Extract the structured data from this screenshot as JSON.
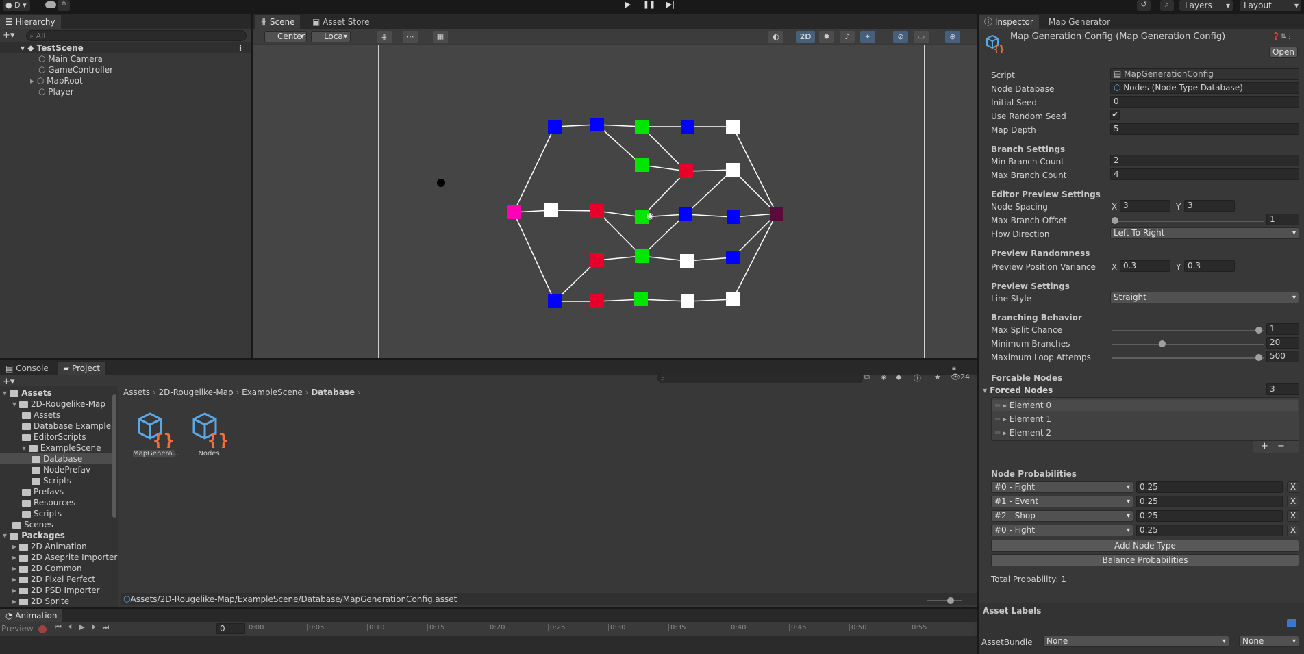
{
  "top": {
    "account": "D",
    "layers": "Layers",
    "layout": "Layout"
  },
  "hierarchy": {
    "tab": "Hierarchy",
    "search_placeholder": "All",
    "scene": "TestScene",
    "items": [
      "Main Camera",
      "GameController",
      "MapRoot",
      "Player"
    ]
  },
  "scene_view": {
    "tabs": [
      "Scene",
      "Asset Store"
    ],
    "pivot": "Center",
    "space": "Local",
    "mode_2d": "2D"
  },
  "project": {
    "tabs": [
      "Console",
      "Project"
    ],
    "count": "24",
    "tree": [
      {
        "label": "Assets",
        "level": 0,
        "bold": true
      },
      {
        "label": "2D-Rougelike-Map",
        "level": 1
      },
      {
        "label": "Assets",
        "level": 2
      },
      {
        "label": "Database Example",
        "level": 2
      },
      {
        "label": "EditorScripts",
        "level": 2
      },
      {
        "label": "ExampleScene",
        "level": 2
      },
      {
        "label": "Database",
        "level": 3
      },
      {
        "label": "NodePrefav",
        "level": 3
      },
      {
        "label": "Scripts",
        "level": 3
      },
      {
        "label": "Prefavs",
        "level": 2
      },
      {
        "label": "Resources",
        "level": 2
      },
      {
        "label": "Scripts",
        "level": 2
      },
      {
        "label": "Scenes",
        "level": 1
      },
      {
        "label": "Packages",
        "level": 0,
        "bold": true
      },
      {
        "label": "2D Animation",
        "level": 1
      },
      {
        "label": "2D Aseprite Importer",
        "level": 1
      },
      {
        "label": "2D Common",
        "level": 1
      },
      {
        "label": "2D Pixel Perfect",
        "level": 1
      },
      {
        "label": "2D PSD Importer",
        "level": 1
      },
      {
        "label": "2D Sprite",
        "level": 1
      }
    ],
    "breadcrumb": [
      "Assets",
      "2D-Rougelike-Map",
      "ExampleScene",
      "Database"
    ],
    "assets": [
      "MapGenera...",
      "Nodes"
    ],
    "path": "Assets/2D-Rougelike-Map/ExampleScene/Database/MapGenerationConfig.asset"
  },
  "animation": {
    "tab": "Animation",
    "preview": "Preview",
    "frame": "0",
    "ticks": [
      "0:00",
      "0:05",
      "0:10",
      "0:15",
      "0:20",
      "0:25",
      "0:30",
      "0:35",
      "0:40",
      "0:45",
      "0:50",
      "0:55"
    ]
  },
  "inspector": {
    "tabs": [
      "Inspector",
      "Map Generator"
    ],
    "title": "Map Generation Config (Map Generation Config)",
    "open": "Open",
    "script_label": "Script",
    "script_value": "MapGenerationConfig",
    "nodedb_label": "Node Database",
    "nodedb_value": "Nodes (Node Type Database)",
    "seed_label": "Initial Seed",
    "seed_value": "0",
    "random_label": "Use Random Seed",
    "depth_label": "Map Depth",
    "depth_value": "5",
    "branch_hdr": "Branch Settings",
    "minb_label": "Min Branch Count",
    "minb_value": "2",
    "maxb_label": "Max Branch Count",
    "maxb_value": "4",
    "editor_hdr": "Editor Preview Settings",
    "spacing_label": "Node Spacing",
    "spacing_x": "3",
    "spacing_y": "3",
    "offset_label": "Max Branch Offset",
    "offset_value": "1",
    "flow_label": "Flow Direction",
    "flow_value": "Left To Right",
    "random_hdr": "Preview Randomness",
    "variance_label": "Preview Position Variance",
    "variance_x": "0.3",
    "variance_y": "0.3",
    "preview_hdr": "Preview Settings",
    "line_label": "Line Style",
    "line_value": "Straight",
    "behavior_hdr": "Branching Behavior",
    "split_label": "Max Split Chance",
    "split_value": "1",
    "minbr_label": "Minimum Branches",
    "minbr_value": "20",
    "loop_label": "Maximum Loop Attemps",
    "loop_value": "500",
    "forcable_hdr": "Forcable Nodes",
    "forced_label": "Forced Nodes",
    "forced_count": "3",
    "elements": [
      "Element 0",
      "Element 1",
      "Element 2"
    ],
    "prob_hdr": "Node Probabilities",
    "probs": [
      {
        "type": "#0 - Fight",
        "value": "0.25"
      },
      {
        "type": "#1 - Event",
        "value": "0.25"
      },
      {
        "type": "#2 - Shop",
        "value": "0.25"
      },
      {
        "type": "#0 - Fight",
        "value": "0.25"
      }
    ],
    "add_btn": "Add Node Type",
    "balance_btn": "Balance Probabilities",
    "total": "Total Probability: 1",
    "labels_hdr": "Asset Labels",
    "bundle_label": "AssetBundle",
    "bundle_value": "None",
    "variant_value": "None"
  },
  "colors": {
    "fight": "#0000ff",
    "event": "#00e600",
    "shop": "#e6002a",
    "rest": "#ffffff",
    "start": "#ff00b4",
    "boss": "#5a0a3c"
  }
}
